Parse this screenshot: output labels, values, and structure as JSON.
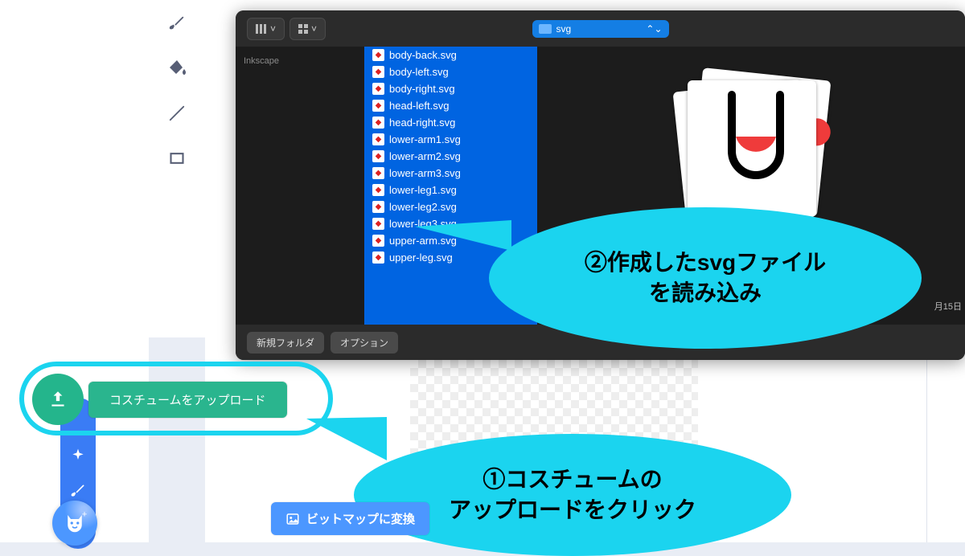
{
  "tools": {
    "brush": "brush-icon",
    "fill": "fill-icon",
    "line": "line-icon",
    "rect": "rect-icon",
    "eraser": "eraser-icon"
  },
  "finder": {
    "sidebar_label": "Inkscape",
    "path_label": "svg",
    "view_seg1": "columns",
    "view_seg2": "grid",
    "new_folder_label": "新規フォルダ",
    "options_label": "オプション",
    "meta_date_fragment": "月15日",
    "files": [
      "body-back.svg",
      "body-left.svg",
      "body-right.svg",
      "head-left.svg",
      "head-right.svg",
      "lower-arm1.svg",
      "lower-arm2.svg",
      "lower-arm3.svg",
      "lower-leg1.svg",
      "lower-leg2.svg",
      "lower-leg3.svg",
      "upper-arm.svg",
      "upper-leg.svg"
    ]
  },
  "upload": {
    "button_label": "コスチュームをアップロード"
  },
  "bubbles": {
    "b1_line1": "②作成したsvgファイル",
    "b1_line2": "を読み込み",
    "b2_line1": "①コスチュームの",
    "b2_line2": "アップロードをクリック"
  },
  "bitmap_button": "ビットマップに変換"
}
